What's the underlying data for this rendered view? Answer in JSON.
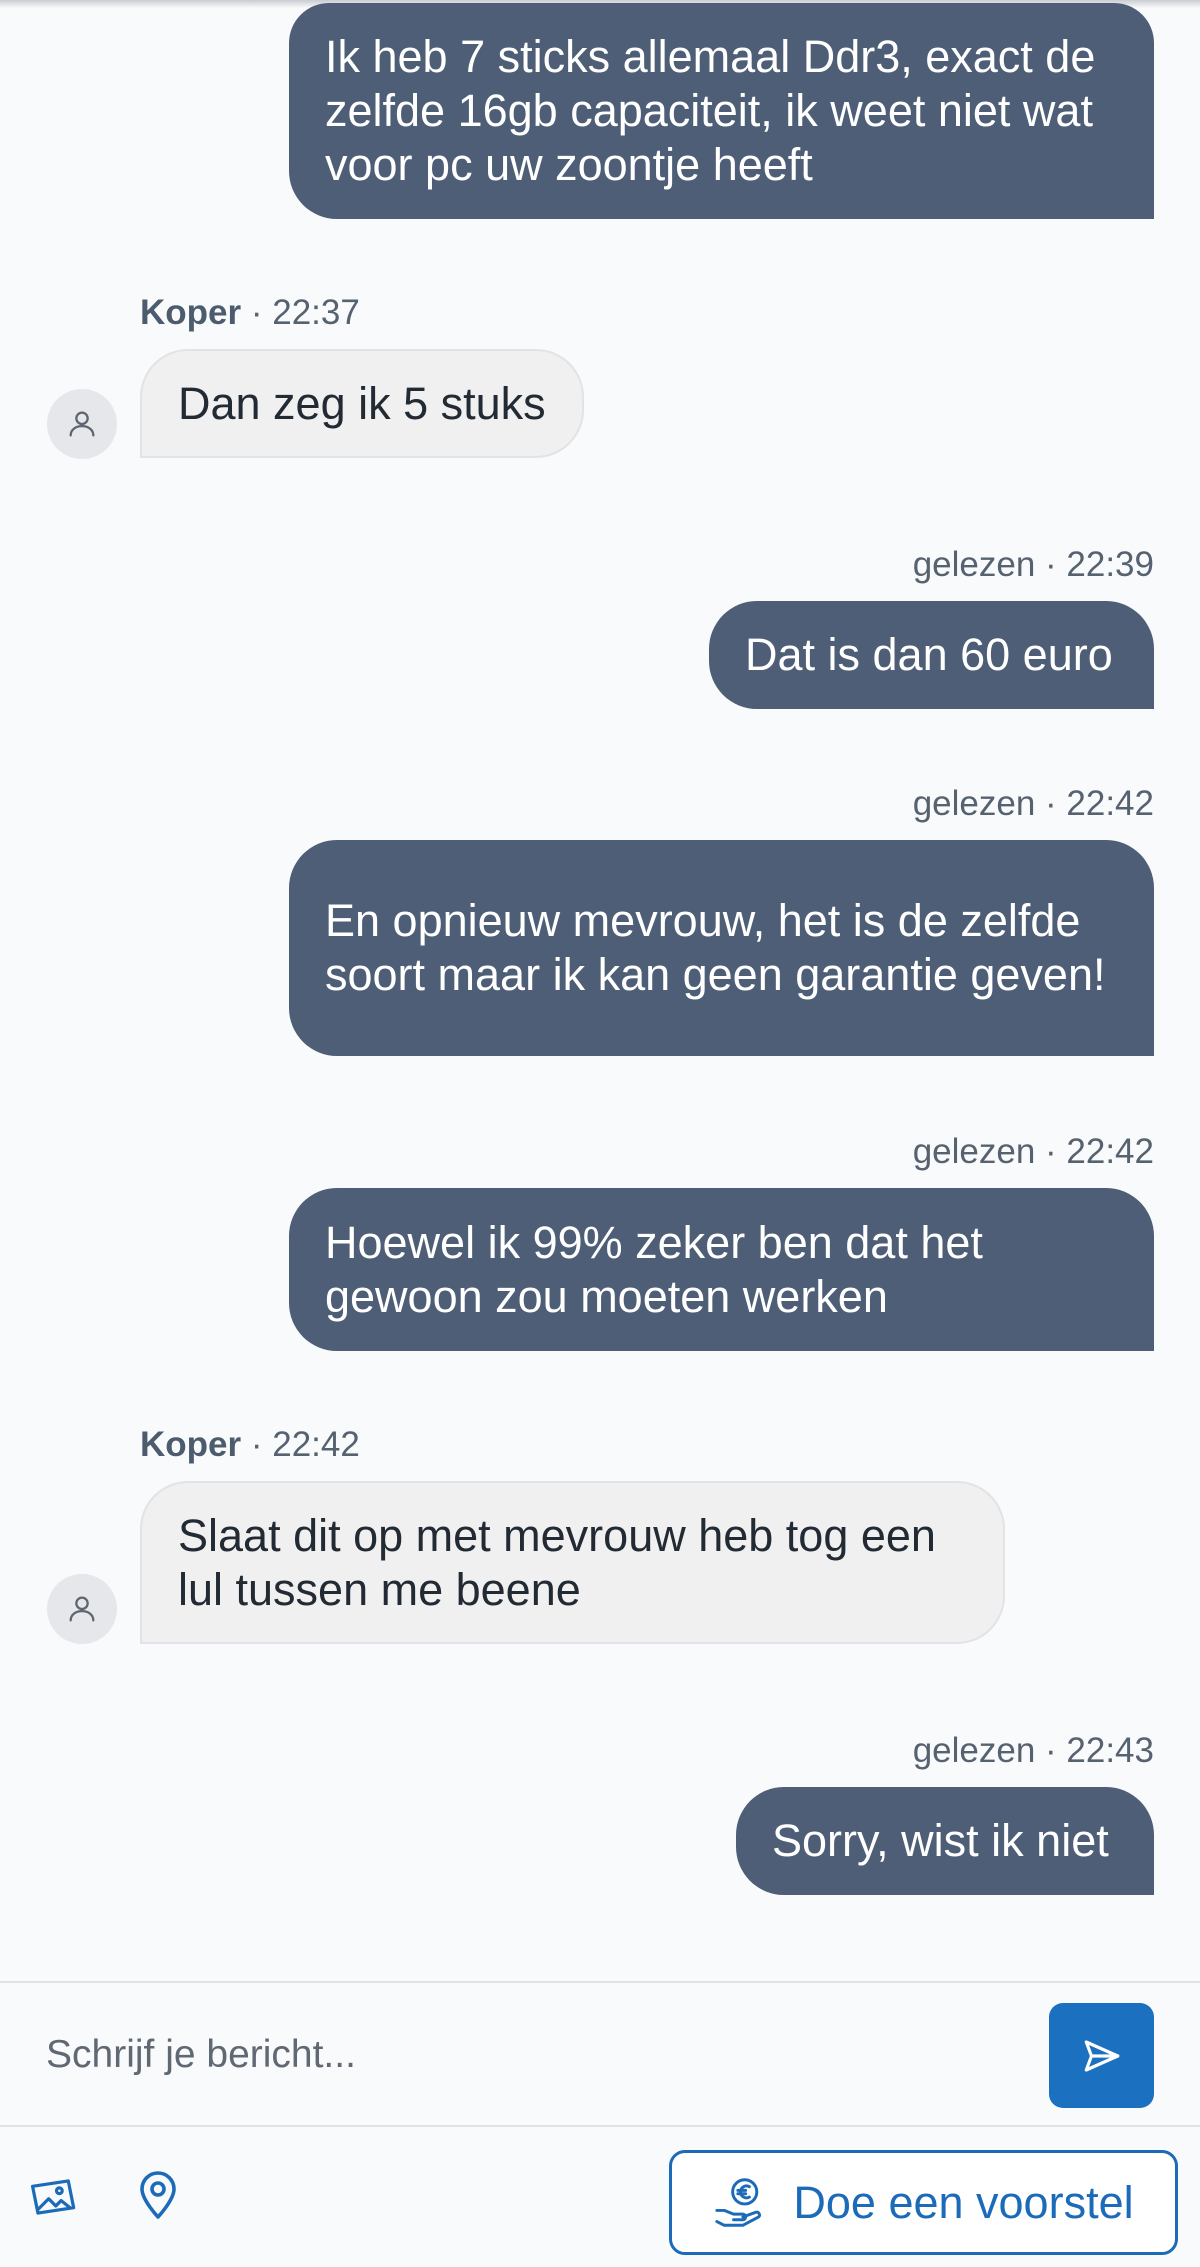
{
  "messages": [
    {
      "direction": "out",
      "text": "Ik heb 7 sticks allemaal Ddr3, exact de zelfde 16gb capaciteit, ik weet niet wat voor pc uw zoontje heeft"
    },
    {
      "direction": "in",
      "sender": "Koper",
      "time": "22:37",
      "text": "Dan zeg ik 5 stuks"
    },
    {
      "direction": "out",
      "status": "gelezen",
      "time": "22:39",
      "text": "Dat is dan 60 euro"
    },
    {
      "direction": "out",
      "status": "gelezen",
      "time": "22:42",
      "text": "En opnieuw mevrouw, het is de zelfde soort maar ik kan geen garantie geven!"
    },
    {
      "direction": "out",
      "status": "gelezen",
      "time": "22:42",
      "text": "Hoewel ik 99% zeker ben dat het gewoon zou moeten werken"
    },
    {
      "direction": "in",
      "sender": "Koper",
      "time": "22:42",
      "text": "Slaat dit op met mevrouw heb tog een lul tussen me beene"
    },
    {
      "direction": "out",
      "status": "gelezen",
      "time": "22:43",
      "text": "Sorry, wist ik niet"
    }
  ],
  "meta_separator": " · ",
  "composer": {
    "placeholder": "Schrijf je bericht...",
    "send_icon": "send-icon"
  },
  "toolbar": {
    "photo_icon": "image-icon",
    "location_icon": "location-pin-icon",
    "offer_icon": "hand-euro-icon",
    "offer_label": "Doe een voorstel"
  },
  "colors": {
    "outgoing_bubble": "#4d5e76",
    "incoming_bubble": "#f0f0f1",
    "accent": "#1c70c0",
    "background": "#f9fafb"
  }
}
